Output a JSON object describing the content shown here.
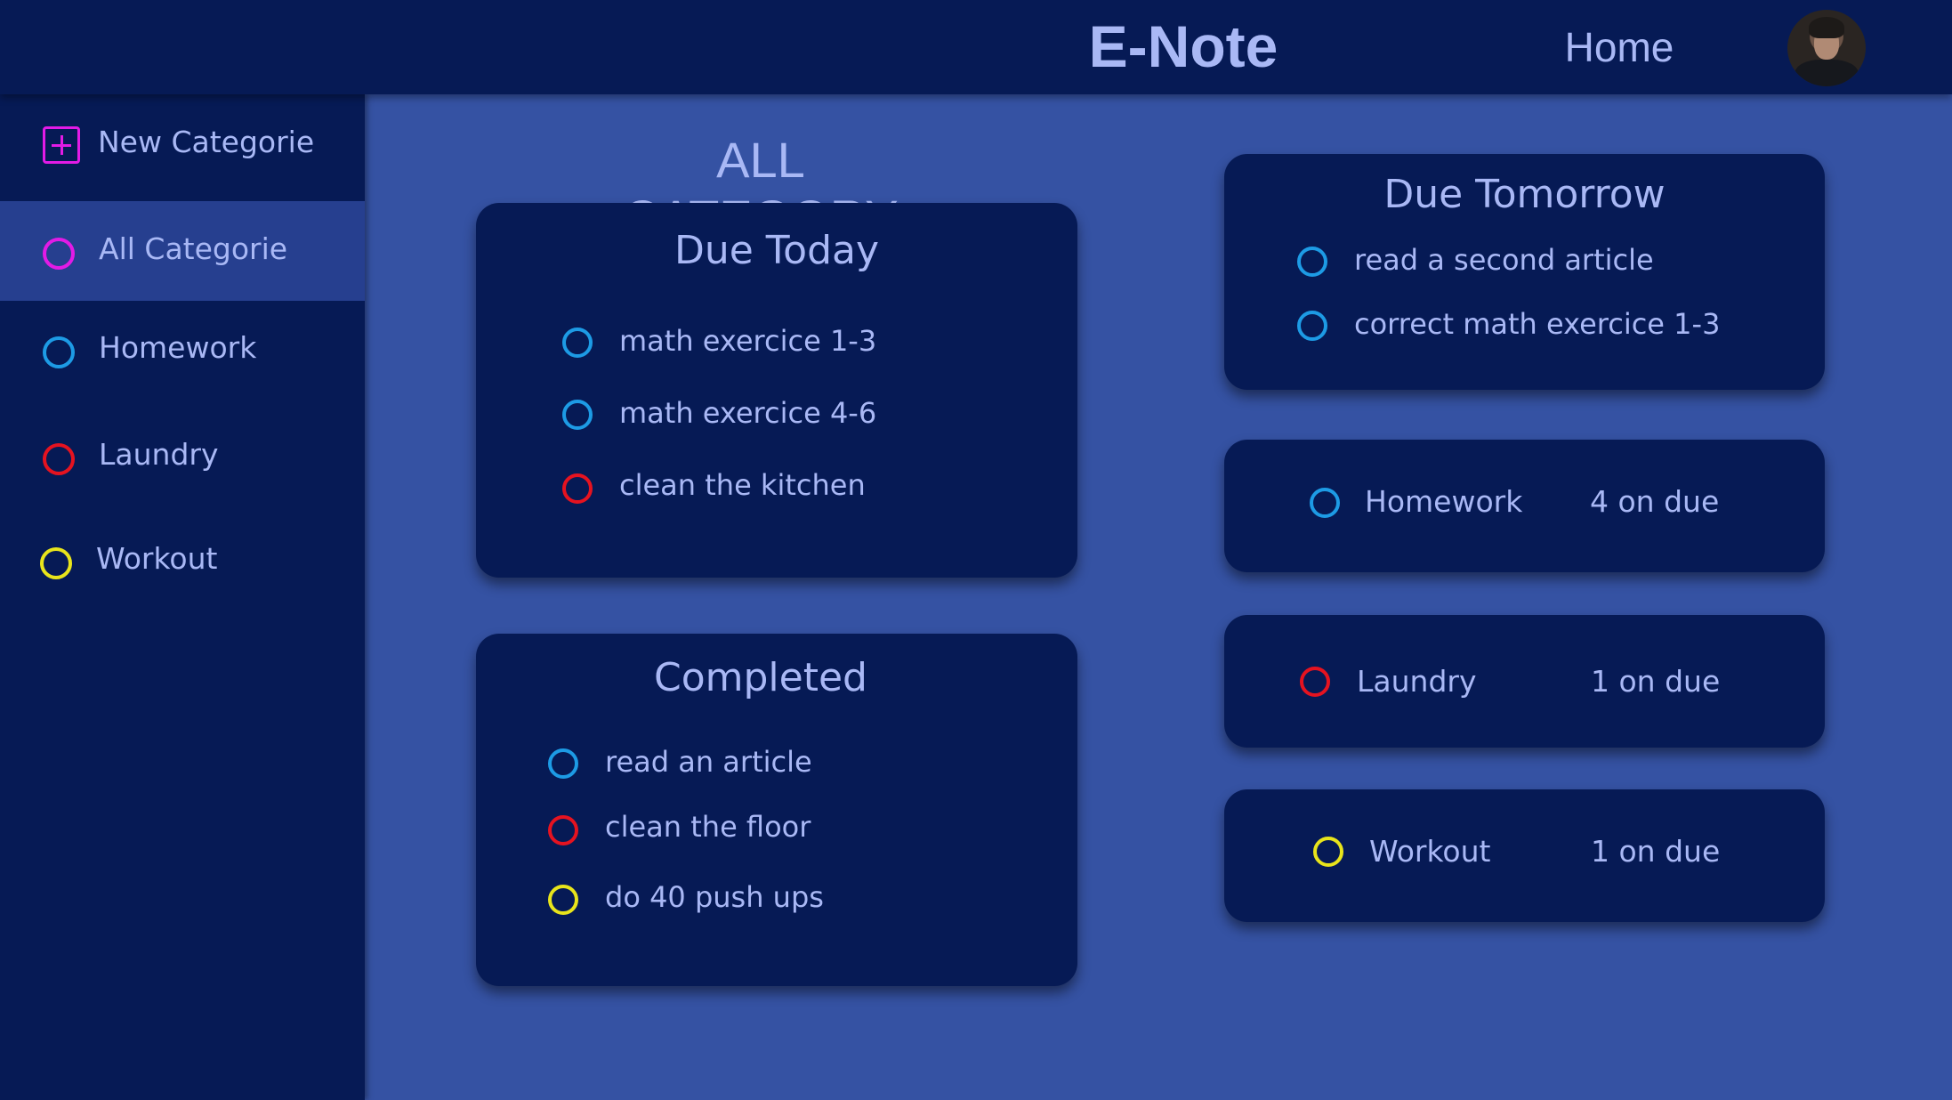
{
  "header": {
    "app_title": "E-Note",
    "home_label": "Home",
    "avatar_icon": "user-avatar"
  },
  "colors": {
    "header_bg": "#061a55",
    "main_bg": "#3552a3",
    "card_bg": "#061a55",
    "text": "#a9b8f5",
    "homework": "#1d9be5",
    "laundry": "#e51320",
    "workout": "#e8e41b",
    "all": "#e21be6"
  },
  "sidebar": {
    "new_category_label": "New Categorie",
    "items": [
      {
        "label": "All Categorie",
        "color": "#e21be6",
        "active": true
      },
      {
        "label": "Homework",
        "color": "#1d9be5",
        "active": false
      },
      {
        "label": "Laundry",
        "color": "#e51320",
        "active": false
      },
      {
        "label": "Workout",
        "color": "#e8e41b",
        "active": false
      }
    ]
  },
  "main": {
    "heading": "ALL CATEGORY",
    "due_today": {
      "title": "Due Today",
      "tasks": [
        {
          "text": "math exercice 1-3",
          "category": "Homework"
        },
        {
          "text": "math exercice 4-6",
          "category": "Homework"
        },
        {
          "text": "clean the kitchen",
          "category": "Laundry"
        }
      ]
    },
    "completed": {
      "title": "Completed",
      "tasks": [
        {
          "text": "read an article",
          "category": "Homework"
        },
        {
          "text": "clean the floor",
          "category": "Laundry"
        },
        {
          "text": "do 40 push ups",
          "category": "Workout"
        }
      ]
    },
    "due_tomorrow": {
      "title": "Due Tomorrow",
      "tasks": [
        {
          "text": "read a second article",
          "category": "Homework"
        },
        {
          "text": "correct math exercice 1-3",
          "category": "Homework"
        }
      ]
    },
    "category_summaries": [
      {
        "name": "Homework",
        "count": "4 on due"
      },
      {
        "name": "Laundry",
        "count": "1 on due"
      },
      {
        "name": "Workout",
        "count": "1 on due"
      }
    ]
  }
}
